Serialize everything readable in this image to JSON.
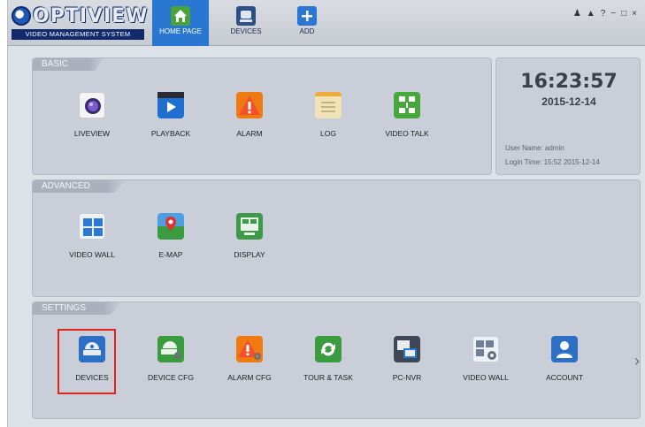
{
  "brand": {
    "name": "OPTIVIEW",
    "subtitle": "VIDEO MANAGEMENT SYSTEM"
  },
  "nav": {
    "tabs": [
      {
        "label": "HOME PAGE",
        "icon": "home-icon",
        "active": true
      },
      {
        "label": "DEVICES",
        "icon": "devices-icon",
        "active": false
      },
      {
        "label": "ADD",
        "icon": "plus-icon",
        "active": false
      }
    ]
  },
  "window_controls": {
    "glyphs": "⚠ ▲ ? − ◻ ✕",
    "icons": [
      "user-icon",
      "lock-icon",
      "help-icon",
      "minimize-icon",
      "restore-icon",
      "close-icon"
    ]
  },
  "clock": {
    "time": "16:23:57",
    "date": "2015-12-14",
    "user_line": "User Name: admin",
    "login_line": "Login Time: 15:52 2015-12-14"
  },
  "sections": {
    "basic": {
      "title": "BASIC",
      "items": [
        {
          "label": "LIVEVIEW",
          "icon": "liveview-icon",
          "color": "#6a4bb3"
        },
        {
          "label": "PLAYBACK",
          "icon": "playback-icon",
          "color": "#1f6fd1"
        },
        {
          "label": "ALARM",
          "icon": "alarm-icon",
          "color": "#ef7a12"
        },
        {
          "label": "LOG",
          "icon": "log-icon",
          "color": "#f1e3b8"
        },
        {
          "label": "VIDEO TALK",
          "icon": "video-talk-icon",
          "color": "#46a73a"
        }
      ]
    },
    "advanced": {
      "title": "ADVANCED",
      "items": [
        {
          "label": "VIDEO WALL",
          "icon": "video-wall-icon",
          "color": "#2c79d0"
        },
        {
          "label": "E-MAP",
          "icon": "emap-icon",
          "color": "#3a9c3f"
        },
        {
          "label": "DISPLAY",
          "icon": "display-icon",
          "color": "#3d9a48"
        }
      ]
    },
    "settings": {
      "title": "SETTINGS",
      "items": [
        {
          "label": "DEVICES",
          "icon": "device-icon",
          "color": "#2d6fc4"
        },
        {
          "label": "DEVICE CFG",
          "icon": "device-cfg-icon",
          "color": "#3a9c3f"
        },
        {
          "label": "ALARM CFG",
          "icon": "alarm-cfg-icon",
          "color": "#ef7a12"
        },
        {
          "label": "TOUR & TASK",
          "icon": "tour-task-icon",
          "color": "#3a9c3f"
        },
        {
          "label": "PC-NVR",
          "icon": "pc-nvr-icon",
          "color": "#3f4656"
        },
        {
          "label": "VIDEO WALL",
          "icon": "video-wall-cfg-icon",
          "color": "#6f7f99"
        },
        {
          "label": "ACCOUNT",
          "icon": "account-icon",
          "color": "#2d6fc4"
        }
      ]
    }
  },
  "more_glyph": "›"
}
